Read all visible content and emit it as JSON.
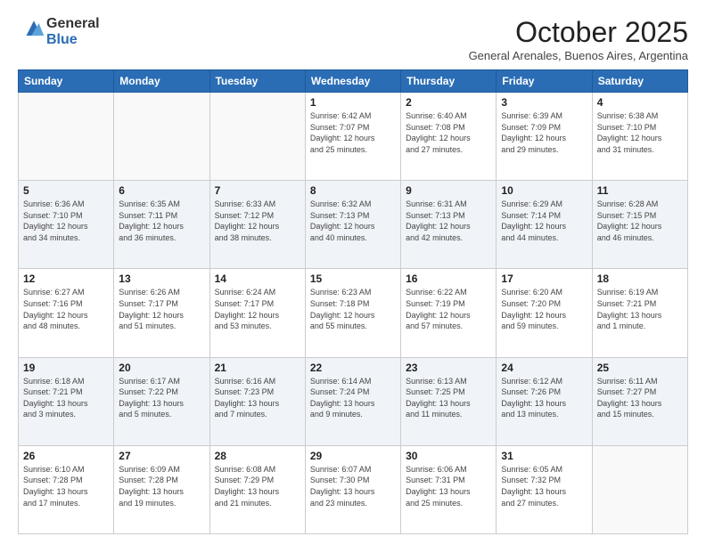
{
  "header": {
    "logo_general": "General",
    "logo_blue": "Blue",
    "month_title": "October 2025",
    "location": "General Arenales, Buenos Aires, Argentina"
  },
  "weekdays": [
    "Sunday",
    "Monday",
    "Tuesday",
    "Wednesday",
    "Thursday",
    "Friday",
    "Saturday"
  ],
  "weeks": [
    [
      {
        "day": "",
        "info": ""
      },
      {
        "day": "",
        "info": ""
      },
      {
        "day": "",
        "info": ""
      },
      {
        "day": "1",
        "info": "Sunrise: 6:42 AM\nSunset: 7:07 PM\nDaylight: 12 hours\nand 25 minutes."
      },
      {
        "day": "2",
        "info": "Sunrise: 6:40 AM\nSunset: 7:08 PM\nDaylight: 12 hours\nand 27 minutes."
      },
      {
        "day": "3",
        "info": "Sunrise: 6:39 AM\nSunset: 7:09 PM\nDaylight: 12 hours\nand 29 minutes."
      },
      {
        "day": "4",
        "info": "Sunrise: 6:38 AM\nSunset: 7:10 PM\nDaylight: 12 hours\nand 31 minutes."
      }
    ],
    [
      {
        "day": "5",
        "info": "Sunrise: 6:36 AM\nSunset: 7:10 PM\nDaylight: 12 hours\nand 34 minutes."
      },
      {
        "day": "6",
        "info": "Sunrise: 6:35 AM\nSunset: 7:11 PM\nDaylight: 12 hours\nand 36 minutes."
      },
      {
        "day": "7",
        "info": "Sunrise: 6:33 AM\nSunset: 7:12 PM\nDaylight: 12 hours\nand 38 minutes."
      },
      {
        "day": "8",
        "info": "Sunrise: 6:32 AM\nSunset: 7:13 PM\nDaylight: 12 hours\nand 40 minutes."
      },
      {
        "day": "9",
        "info": "Sunrise: 6:31 AM\nSunset: 7:13 PM\nDaylight: 12 hours\nand 42 minutes."
      },
      {
        "day": "10",
        "info": "Sunrise: 6:29 AM\nSunset: 7:14 PM\nDaylight: 12 hours\nand 44 minutes."
      },
      {
        "day": "11",
        "info": "Sunrise: 6:28 AM\nSunset: 7:15 PM\nDaylight: 12 hours\nand 46 minutes."
      }
    ],
    [
      {
        "day": "12",
        "info": "Sunrise: 6:27 AM\nSunset: 7:16 PM\nDaylight: 12 hours\nand 48 minutes."
      },
      {
        "day": "13",
        "info": "Sunrise: 6:26 AM\nSunset: 7:17 PM\nDaylight: 12 hours\nand 51 minutes."
      },
      {
        "day": "14",
        "info": "Sunrise: 6:24 AM\nSunset: 7:17 PM\nDaylight: 12 hours\nand 53 minutes."
      },
      {
        "day": "15",
        "info": "Sunrise: 6:23 AM\nSunset: 7:18 PM\nDaylight: 12 hours\nand 55 minutes."
      },
      {
        "day": "16",
        "info": "Sunrise: 6:22 AM\nSunset: 7:19 PM\nDaylight: 12 hours\nand 57 minutes."
      },
      {
        "day": "17",
        "info": "Sunrise: 6:20 AM\nSunset: 7:20 PM\nDaylight: 12 hours\nand 59 minutes."
      },
      {
        "day": "18",
        "info": "Sunrise: 6:19 AM\nSunset: 7:21 PM\nDaylight: 13 hours\nand 1 minute."
      }
    ],
    [
      {
        "day": "19",
        "info": "Sunrise: 6:18 AM\nSunset: 7:21 PM\nDaylight: 13 hours\nand 3 minutes."
      },
      {
        "day": "20",
        "info": "Sunrise: 6:17 AM\nSunset: 7:22 PM\nDaylight: 13 hours\nand 5 minutes."
      },
      {
        "day": "21",
        "info": "Sunrise: 6:16 AM\nSunset: 7:23 PM\nDaylight: 13 hours\nand 7 minutes."
      },
      {
        "day": "22",
        "info": "Sunrise: 6:14 AM\nSunset: 7:24 PM\nDaylight: 13 hours\nand 9 minutes."
      },
      {
        "day": "23",
        "info": "Sunrise: 6:13 AM\nSunset: 7:25 PM\nDaylight: 13 hours\nand 11 minutes."
      },
      {
        "day": "24",
        "info": "Sunrise: 6:12 AM\nSunset: 7:26 PM\nDaylight: 13 hours\nand 13 minutes."
      },
      {
        "day": "25",
        "info": "Sunrise: 6:11 AM\nSunset: 7:27 PM\nDaylight: 13 hours\nand 15 minutes."
      }
    ],
    [
      {
        "day": "26",
        "info": "Sunrise: 6:10 AM\nSunset: 7:28 PM\nDaylight: 13 hours\nand 17 minutes."
      },
      {
        "day": "27",
        "info": "Sunrise: 6:09 AM\nSunset: 7:28 PM\nDaylight: 13 hours\nand 19 minutes."
      },
      {
        "day": "28",
        "info": "Sunrise: 6:08 AM\nSunset: 7:29 PM\nDaylight: 13 hours\nand 21 minutes."
      },
      {
        "day": "29",
        "info": "Sunrise: 6:07 AM\nSunset: 7:30 PM\nDaylight: 13 hours\nand 23 minutes."
      },
      {
        "day": "30",
        "info": "Sunrise: 6:06 AM\nSunset: 7:31 PM\nDaylight: 13 hours\nand 25 minutes."
      },
      {
        "day": "31",
        "info": "Sunrise: 6:05 AM\nSunset: 7:32 PM\nDaylight: 13 hours\nand 27 minutes."
      },
      {
        "day": "",
        "info": ""
      }
    ]
  ]
}
